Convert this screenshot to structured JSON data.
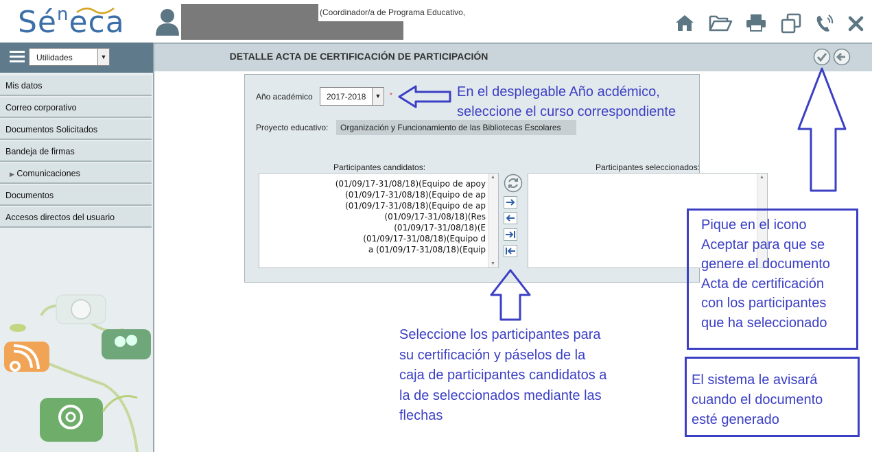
{
  "header": {
    "logo_main": "Sé",
    "logo_sup": "n",
    "logo_end": "eca",
    "user_role": "(Coordinador/a de Programa Educativo,",
    "toolbar_icons": [
      "home-icon",
      "folder-open-icon",
      "print-icon",
      "windows-icon",
      "phone-icon",
      "close-icon"
    ]
  },
  "sidebar": {
    "select_value": "Utilidades",
    "items": [
      {
        "label": "Mis datos"
      },
      {
        "label": "Correo corporativo"
      },
      {
        "label": "Documentos Solicitados"
      },
      {
        "label": "Bandeja de firmas"
      },
      {
        "label": "Comunicaciones",
        "prefix": "▶"
      },
      {
        "label": "Documentos"
      },
      {
        "label": "Accesos directos del usuario"
      }
    ]
  },
  "main": {
    "title": "DETALLE ACTA DE CERTIFICACIÓN DE PARTICIPACIÓN",
    "form": {
      "year_label": "Año académico",
      "year_value": "2017-2018",
      "required_mark": "*",
      "project_label": "Proyecto educativo:",
      "project_value": "Organización y Funcionamiento de las Bibliotecas Escolares"
    },
    "candidates_title": "Participantes candidatos:",
    "selected_title": "Participantes seleccionados:",
    "candidates": [
      "(01/09/17-31/08/18)(Equipo de apoy",
      "(01/09/17-31/08/18)(Equipo de ap",
      "(01/09/17-31/08/18)(Equipo de ap",
      "(01/09/17-31/08/18)(Res",
      "(01/09/17-31/08/18)(E",
      "(01/09/17-31/08/18)(Equipo d",
      "a (01/09/17-31/08/18)(Equip"
    ]
  },
  "annotations": {
    "year_note": [
      "En el desplegable Año acdémico,",
      "seleccione el curso correspondiente"
    ],
    "select_note": [
      "Seleccione los participantes para",
      "su certificación y páselos de la",
      "caja de participantes candidatos a",
      "la de seleccionados mediante las",
      "flechas"
    ],
    "accept_note": [
      "Pique en el icono",
      "Aceptar para que se",
      "genere el documento",
      "Acta de certificación",
      "con los participantes",
      "que ha seleccionado"
    ],
    "warn_note": [
      "El sistema le avisará",
      "cuando el documento",
      "esté generado"
    ]
  },
  "colors": {
    "annotation": "#3b3fc4",
    "menu_bar": "#5f7a8a",
    "title_bar": "#c9d5da"
  }
}
